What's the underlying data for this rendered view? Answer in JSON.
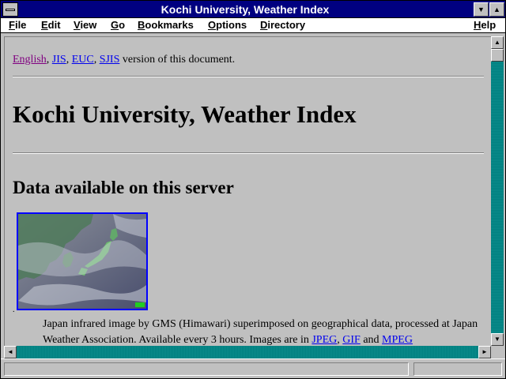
{
  "window": {
    "title": "Kochi University, Weather Index"
  },
  "menubar": {
    "items": [
      {
        "label": "File",
        "acc": "F",
        "rest": "ile"
      },
      {
        "label": "Edit",
        "acc": "E",
        "rest": "dit"
      },
      {
        "label": "View",
        "acc": "V",
        "rest": "iew"
      },
      {
        "label": "Go",
        "acc": "G",
        "rest": "o"
      },
      {
        "label": "Bookmarks",
        "acc": "B",
        "rest": "ookmarks"
      },
      {
        "label": "Options",
        "acc": "O",
        "rest": "ptions"
      },
      {
        "label": "Directory",
        "acc": "D",
        "rest": "irectory"
      },
      {
        "label": "Help",
        "acc": "H",
        "rest": "elp"
      }
    ]
  },
  "content": {
    "lang_links": [
      "English",
      "JIS",
      "EUC",
      "SJIS"
    ],
    "lang_suffix": "version of this document.",
    "heading": "Kochi University, Weather Index",
    "subheading": "Data available on this server",
    "image_dot": ".",
    "desc_text": "Japan infrared image by GMS (Himawari) superimposed on geographical data, processed at Japan Weather Association. Available every 3 hours. Images are in ",
    "desc_links": [
      "JPEG",
      "GIF",
      "MPEG"
    ],
    "desc_and": " and ",
    "desc_comma": ", "
  },
  "icons": {
    "scroll_up": "up-arrow-icon",
    "scroll_down": "down-arrow-icon",
    "scroll_left": "left-arrow-icon",
    "scroll_right": "right-arrow-icon"
  },
  "colors": {
    "titlebar": "#000080",
    "link": "#0000ee",
    "visited": "#800080",
    "scrollbar": "#008080"
  }
}
